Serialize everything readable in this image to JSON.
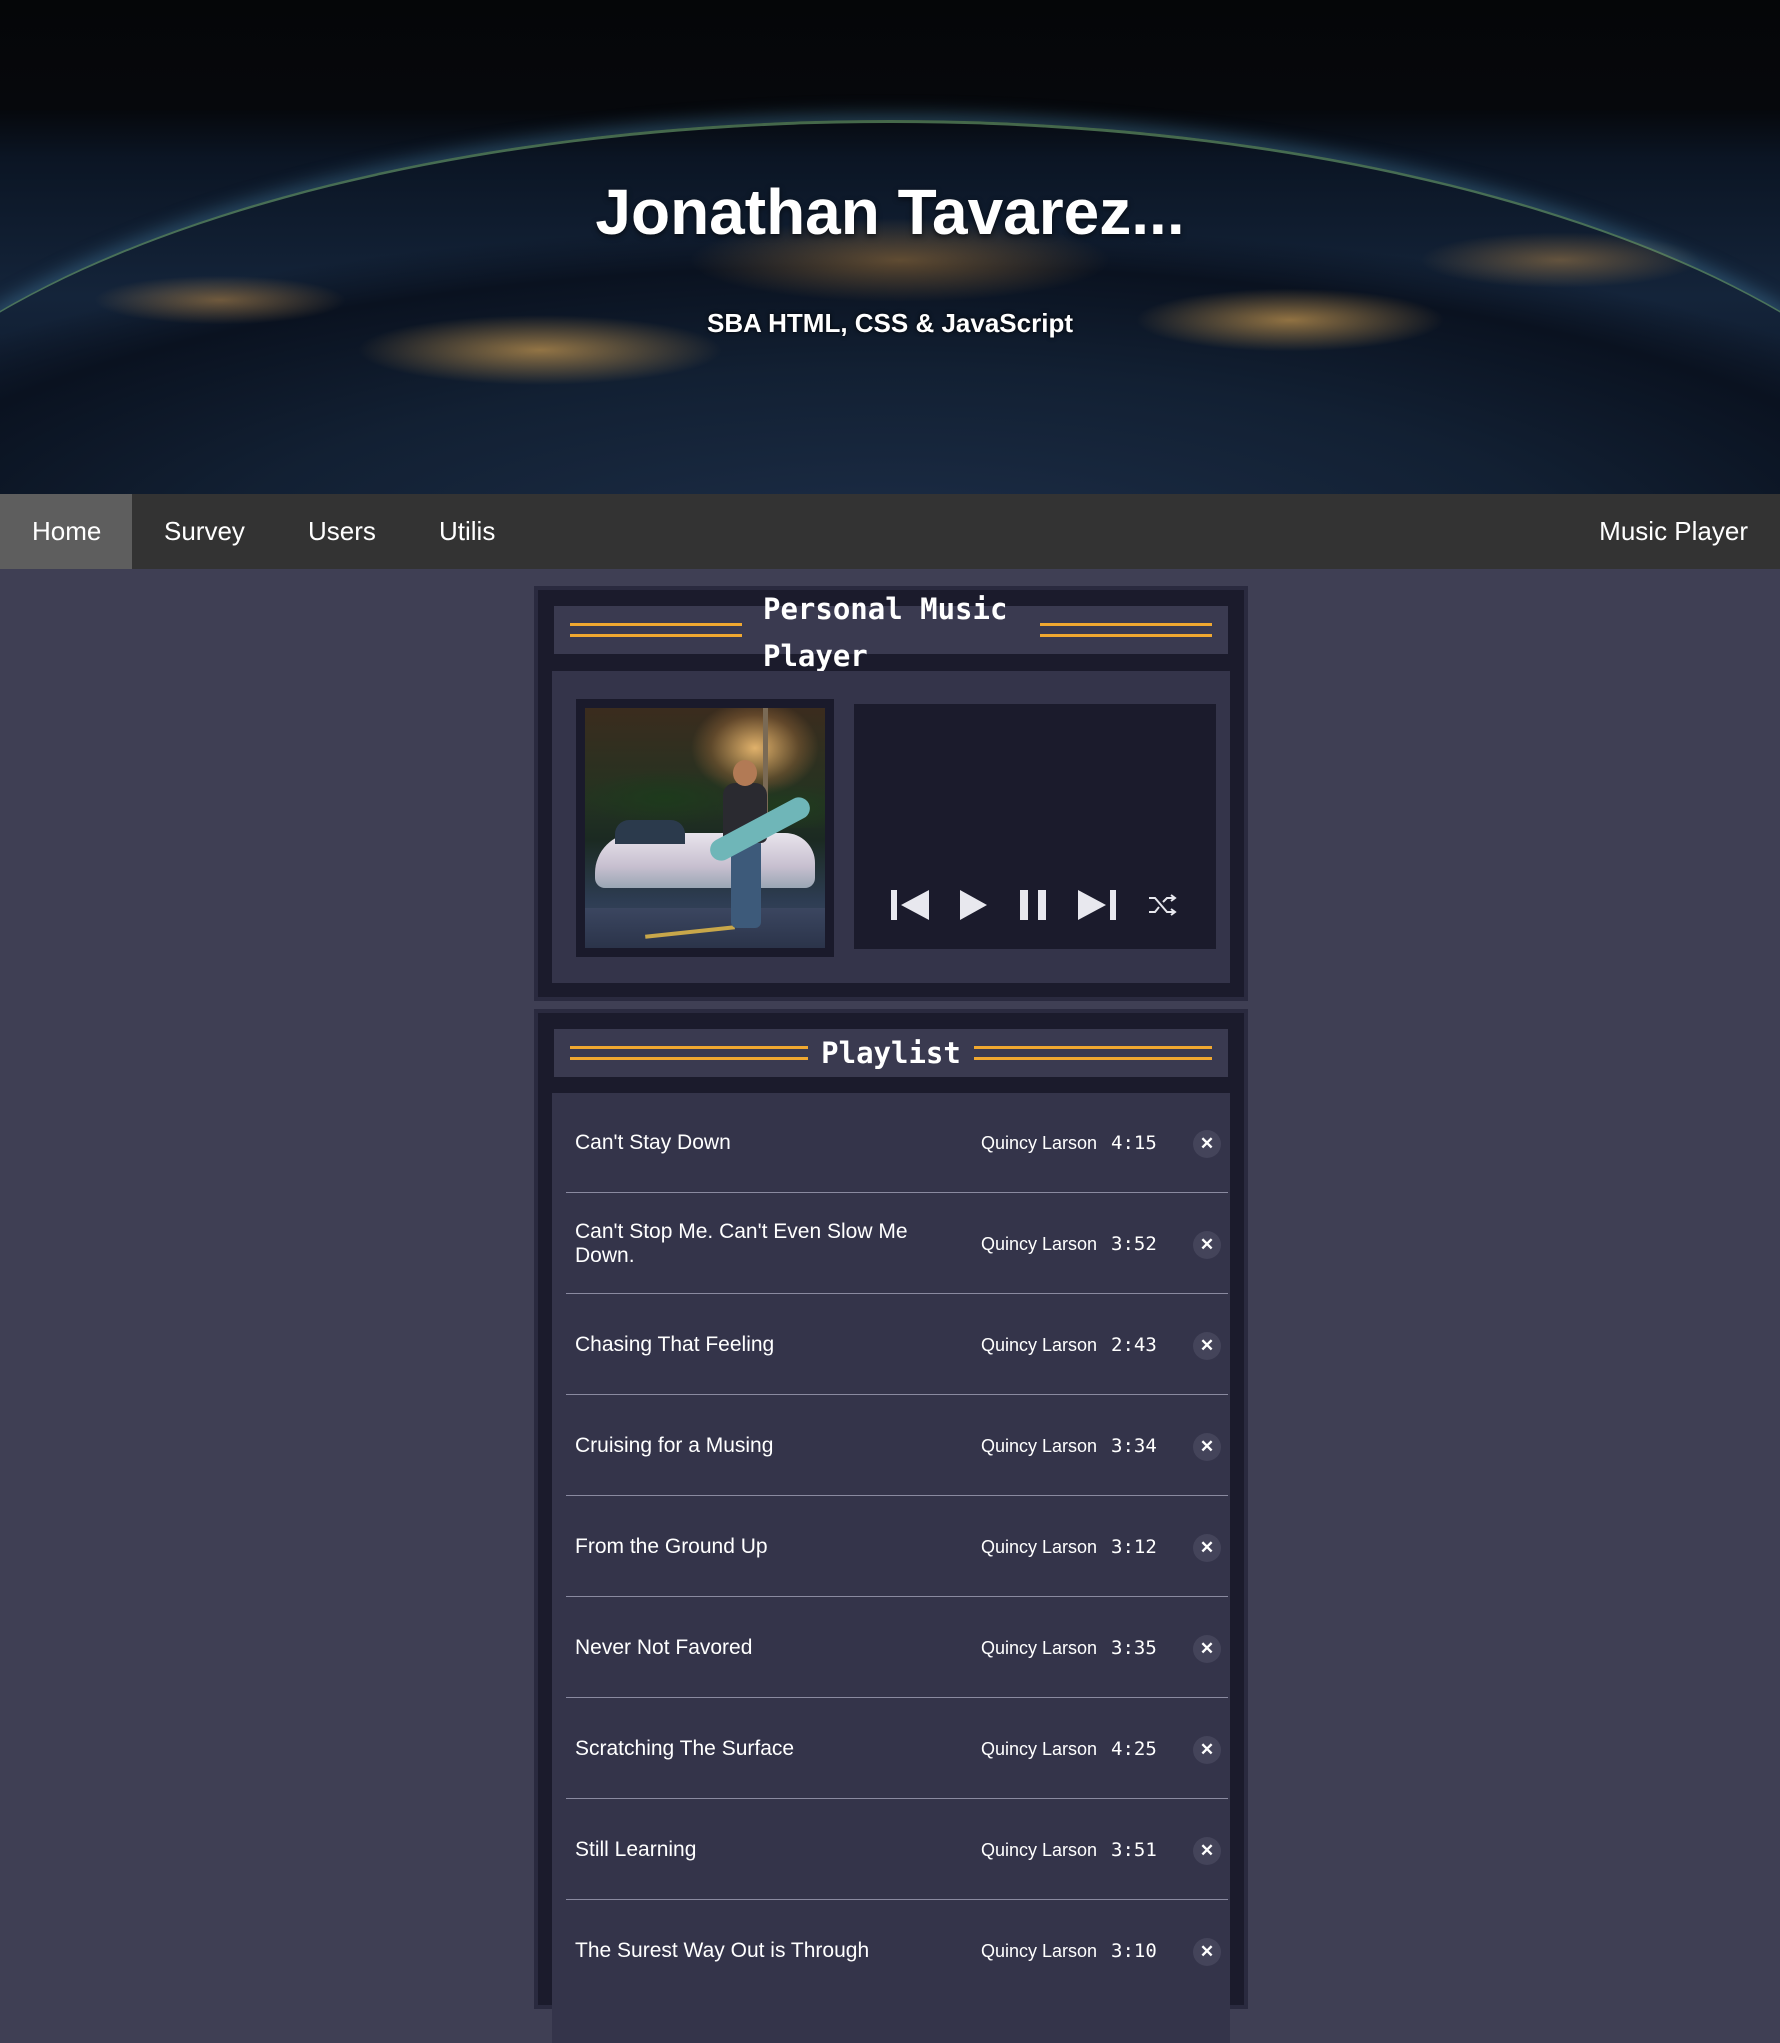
{
  "header": {
    "title": "Jonathan Tavarez...",
    "subtitle": "SBA HTML, CSS & JavaScript"
  },
  "nav": {
    "items": [
      {
        "label": "Home",
        "active": true
      },
      {
        "label": "Survey"
      },
      {
        "label": "Users"
      },
      {
        "label": "Utilis"
      }
    ],
    "right_item": "Music Player"
  },
  "player": {
    "title_line1": "Personal Music",
    "title_line2": "Player",
    "controls": [
      "previous-icon",
      "play-icon",
      "pause-icon",
      "next-icon",
      "shuffle-icon"
    ]
  },
  "playlist": {
    "title": "Playlist",
    "delete_symbol": "✕",
    "tracks": [
      {
        "title": "Can't Stay Down",
        "artist": "Quincy Larson",
        "duration": "4:15"
      },
      {
        "title": "Can't Stop Me. Can't Even Slow Me Down.",
        "artist": "Quincy Larson",
        "duration": "3:52"
      },
      {
        "title": "Chasing That Feeling",
        "artist": "Quincy Larson",
        "duration": "2:43"
      },
      {
        "title": "Cruising for a Musing",
        "artist": "Quincy Larson",
        "duration": "3:34"
      },
      {
        "title": "From the Ground Up",
        "artist": "Quincy Larson",
        "duration": "3:12"
      },
      {
        "title": "Never Not Favored",
        "artist": "Quincy Larson",
        "duration": "3:35"
      },
      {
        "title": "Scratching The Surface",
        "artist": "Quincy Larson",
        "duration": "4:25"
      },
      {
        "title": "Still Learning",
        "artist": "Quincy Larson",
        "duration": "3:51"
      },
      {
        "title": "The Surest Way Out is Through",
        "artist": "Quincy Larson",
        "duration": "3:10"
      }
    ]
  },
  "colors": {
    "page_bg": "#3f3f54",
    "nav_bg": "#333333",
    "nav_active": "#5e5e5e",
    "accent_gold": "#f0a830",
    "panel_bg": "#1b1b2c"
  }
}
